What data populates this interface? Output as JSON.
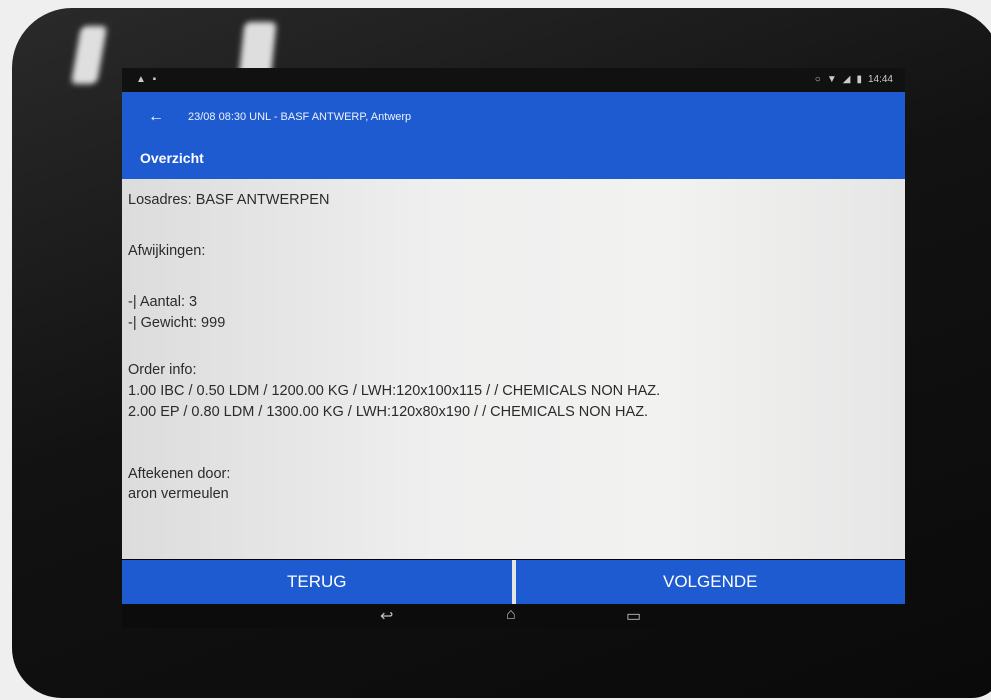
{
  "status_bar": {
    "left_icons": "▲ ▪",
    "right_icons": [
      "○",
      "▼",
      "◢",
      "▮"
    ],
    "time": "14:44"
  },
  "app_bar": {
    "back_icon": "arrow-left-icon",
    "trip_title": "23/08 08:30 UNL - BASF ANTWERP, Antwerp",
    "section_title": "Overzicht"
  },
  "content": {
    "losadres": "Losadres: BASF ANTWERPEN",
    "afwijkingen_label": "Afwijkingen:",
    "aantal": "-| Aantal: 3",
    "gewicht": "-| Gewicht: 999",
    "order_info_label": "Order info:",
    "order_line_1": "1.00 IBC / 0.50 LDM /  1200.00 KG  / LWH:120x100x115 /  / CHEMICALS NON HAZ.",
    "order_line_2": "2.00 EP / 0.80 LDM /  1300.00 KG  / LWH:120x80x190 /  / CHEMICALS NON HAZ.",
    "aftekenen_label": "Aftekenen door:",
    "aftekenen_name": "aron vermeulen"
  },
  "buttons": {
    "back_label": "TERUG",
    "next_label": "VOLGENDE"
  },
  "nav": {
    "back_glyph": "↩",
    "home_glyph": "⌂",
    "recents_glyph": "▭"
  },
  "colors": {
    "accent": "#1e5bd0"
  }
}
